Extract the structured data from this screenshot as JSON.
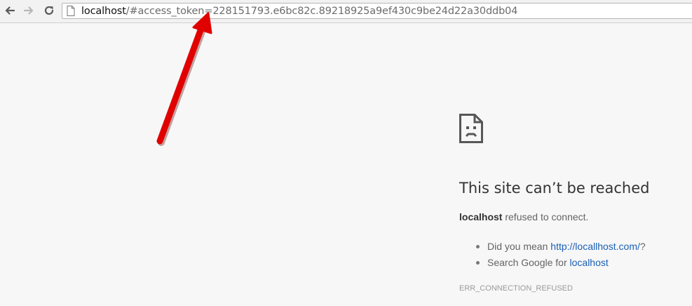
{
  "browser": {
    "url_host": "localhost",
    "url_rest": "/#access_token=228151793.e6bc82c.89218925a9ef430c9be24d22a30ddb04",
    "icons": {
      "back": "back-arrow-icon",
      "forward": "forward-arrow-icon",
      "reload": "reload-icon",
      "page": "page-icon"
    }
  },
  "error": {
    "icon": "sad-page-icon",
    "title": "This site can’t be reached",
    "host": "localhost",
    "message": "refused to connect.",
    "suggestions": [
      {
        "prefix": "Did you mean ",
        "link": "http://locallhost.com/",
        "suffix": "?"
      },
      {
        "prefix": "Search Google for ",
        "link": "localhost",
        "suffix": ""
      }
    ],
    "code": "ERR_CONNECTION_REFUSED"
  },
  "annotation": {
    "arrow_color": "#e10000"
  }
}
